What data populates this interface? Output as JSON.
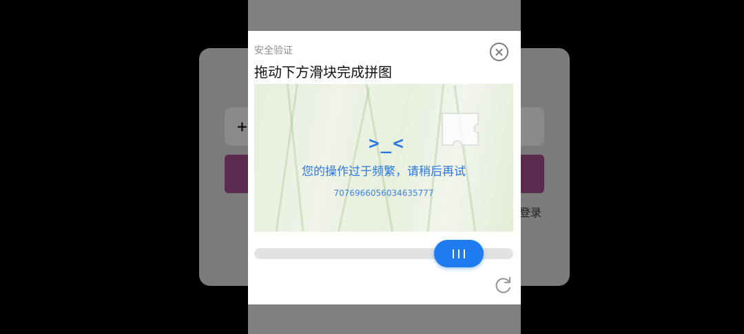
{
  "background": {
    "input_prefix": "+",
    "link_text": "登录"
  },
  "dialog": {
    "subtitle": "安全验证",
    "title": "拖动下方滑块完成拼图",
    "close_icon": "close-circle-icon",
    "error": {
      "face": ">_<",
      "message": "您的操作过于频繁，请稍后再试",
      "code": "7076966056034635777"
    },
    "slider_icon": "slider-grip-icon",
    "refresh_icon": "refresh-icon"
  },
  "colors": {
    "accent": "#1e7bf0",
    "error_text": "#2a78e4",
    "bg_button": "#5a2a4f"
  }
}
